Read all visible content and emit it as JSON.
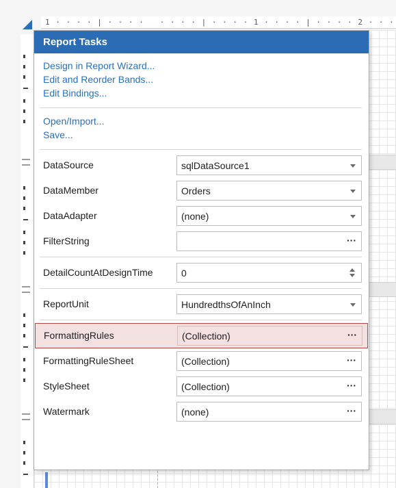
{
  "ruler": {
    "top_text": "1 · · · · | · · · ·   · · · · | · · · · 1 · · · · | · · · · 2 · · ·"
  },
  "panel": {
    "title": "Report Tasks",
    "links_group1": [
      "Design in Report Wizard...",
      "Edit and Reorder Bands...",
      "Edit Bindings..."
    ],
    "links_group2": [
      "Open/Import...",
      "Save..."
    ],
    "properties": {
      "datasource": {
        "label": "DataSource",
        "value": "sqlDataSource1",
        "editor": "dropdown"
      },
      "datamember": {
        "label": "DataMember",
        "value": "Orders",
        "editor": "dropdown"
      },
      "dataadapter": {
        "label": "DataAdapter",
        "value": "(none)",
        "editor": "dropdown"
      },
      "filterstring": {
        "label": "FilterString",
        "value": "",
        "editor": "ellipsis"
      },
      "detailcount": {
        "label": "DetailCountAtDesignTime",
        "value": "0",
        "editor": "spin"
      },
      "reportunit": {
        "label": "ReportUnit",
        "value": "HundredthsOfAnInch",
        "editor": "dropdown"
      },
      "formattingrules": {
        "label": "FormattingRules",
        "value": "(Collection)",
        "editor": "ellipsis"
      },
      "formattingrulesheet": {
        "label": "FormattingRuleSheet",
        "value": "(Collection)",
        "editor": "ellipsis"
      },
      "stylesheet": {
        "label": "StyleSheet",
        "value": "(Collection)",
        "editor": "ellipsis"
      },
      "watermark": {
        "label": "Watermark",
        "value": "(none)",
        "editor": "ellipsis"
      }
    },
    "ellipsis_glyph": "···"
  },
  "colors": {
    "header_bg": "#2b6cb4",
    "link": "#2a6fba",
    "highlight_bg": "#f3e1e1",
    "highlight_border": "#b54545"
  }
}
